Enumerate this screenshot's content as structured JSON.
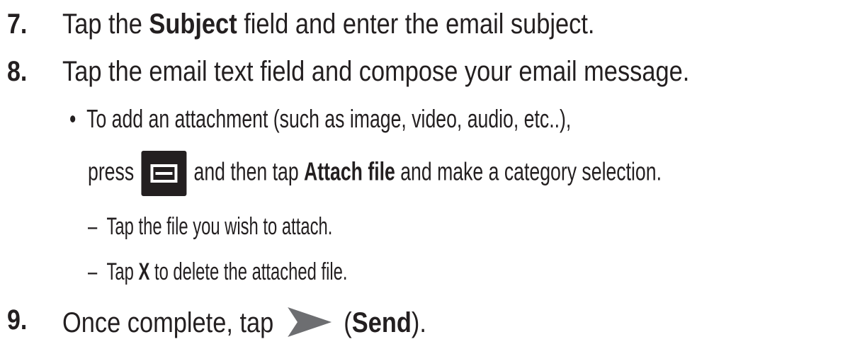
{
  "steps": [
    {
      "number": "7.",
      "pre": "Tap the ",
      "bold": "Subject",
      "post": " field and enter the email subject."
    },
    {
      "number": "8.",
      "text": "Tap the email text field and compose your email message."
    },
    {
      "number": "9.",
      "pre": "Once complete, tap ",
      "paren_open": "(",
      "bold": "Send",
      "post": ")."
    }
  ],
  "bullet": {
    "symbol": "•",
    "line1": "To add an attachment (such as image, video, audio, etc..),",
    "line2_pre": "press ",
    "line2_mid": " and then tap ",
    "line2_bold": "Attach file",
    "line2_post": " and make a category selection."
  },
  "subitems": [
    {
      "dash": "–",
      "text": "Tap the file you wish to attach."
    },
    {
      "dash": "–",
      "pre": "Tap ",
      "bold": "X",
      "post": " to delete the attached file."
    }
  ],
  "icons": {
    "menu_key": "menu-key-icon",
    "send": "send-arrow-icon"
  }
}
